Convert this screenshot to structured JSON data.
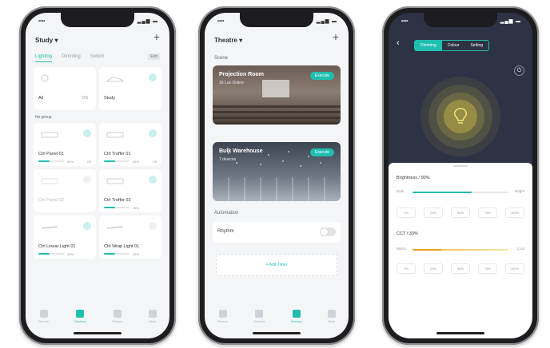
{
  "phone1": {
    "room": "Study",
    "room_caret": "▾",
    "plus": "+",
    "tabs": [
      "Lighting",
      "Dimming",
      "Switch"
    ],
    "edit": "Edit",
    "groups": [
      {
        "name": "All",
        "value": "ON",
        "on": true
      },
      {
        "name": "Study",
        "value": "",
        "on": true
      }
    ],
    "section": "No group",
    "devices": [
      {
        "name": "Ctrl Panel 01",
        "pct": "45%",
        "mode": "Off",
        "on": true
      },
      {
        "name": "Ctrl Troffer 01",
        "pct": "45%",
        "mode": "Off",
        "on": true
      },
      {
        "name": "Ctrl Panel 02",
        "pct": "",
        "mode": "",
        "on": false
      },
      {
        "name": "Ctrl Troffer 02",
        "pct": "45%",
        "mode": "",
        "on": true
      },
      {
        "name": "Ctrl Linear Light 01",
        "pct": "45%",
        "mode": "",
        "on": true
      },
      {
        "name": "Ctrl Wrap Light 01",
        "pct": "45%",
        "mode": "",
        "on": false
      }
    ],
    "nav": [
      "Rooms",
      "Devices",
      "Scenes",
      "More"
    ]
  },
  "phone2": {
    "room": "Theatre",
    "room_caret": "▾",
    "plus": "+",
    "scene_section": "Scene",
    "scenes": [
      {
        "title": "Projection Room",
        "sub": "16 Lux Online",
        "action": "Execute"
      },
      {
        "title": "Bulk Warehouse",
        "sub": "7 devices",
        "action": "Execute"
      }
    ],
    "automation_section": "Automation",
    "rhythm": "Rhythm",
    "add_label": "+ Add Timer",
    "nav": [
      "Rooms",
      "Devices",
      "Scenes",
      "More"
    ]
  },
  "phone3": {
    "back": "‹",
    "segments": [
      "Dimming",
      "Colour",
      "Setting"
    ],
    "brightness_label": "Brightness / 90%",
    "brightness_fraction": 0.62,
    "dark": "Dark",
    "bright": "Bright",
    "brightness_chips": [
      "1%",
      "25%",
      "50%",
      "75%",
      "100%"
    ],
    "cct_label": "CCT / 30%",
    "cct_fraction": 0.3,
    "warm": "Warm",
    "cool": "Cool",
    "cct_chips": [
      "0%",
      "25%",
      "50%",
      "75%",
      "100%"
    ]
  },
  "colors": {
    "accent": "#1fbfb0",
    "dark_panel": "#2d3344",
    "bulb": "#e9d24a"
  }
}
